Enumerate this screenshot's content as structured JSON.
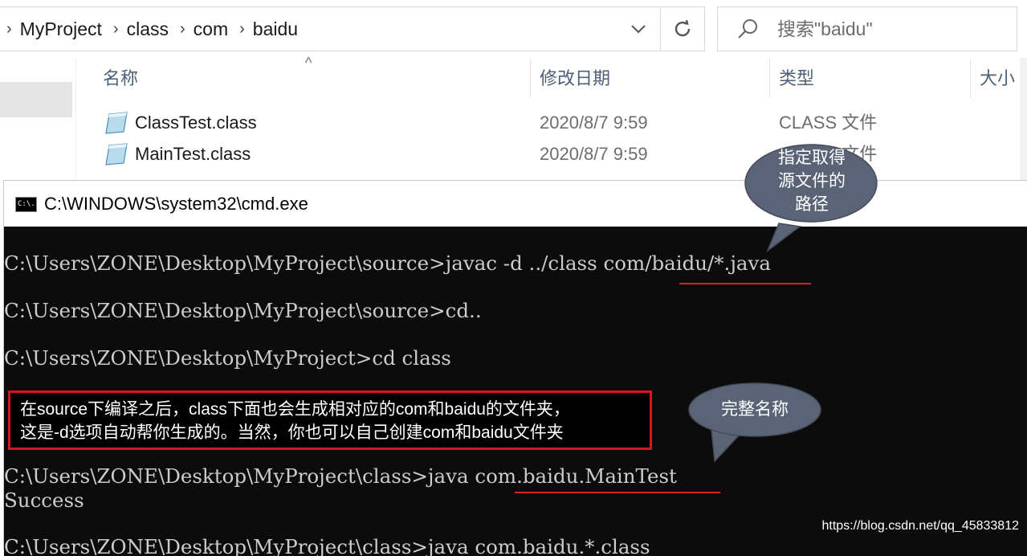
{
  "address_bar": {
    "breadcrumbs": [
      "MyProject",
      "class",
      "com",
      "baidu"
    ],
    "search_placeholder": "搜索\"baidu\""
  },
  "file_list": {
    "columns": [
      "名称",
      "修改日期",
      "类型",
      "大小"
    ],
    "rows": [
      {
        "name": "ClassTest.class",
        "modified": "2020/8/7 9:59",
        "type": "CLASS 文件"
      },
      {
        "name": "MainTest.class",
        "modified": "2020/8/7 9:59",
        "type": "CLASS 文件"
      }
    ]
  },
  "cmd": {
    "title": "C:\\WINDOWS\\system32\\cmd.exe",
    "icon_text": "C:\\.",
    "lines": [
      "C:\\Users\\ZONE\\Desktop\\MyProject\\source>javac -d ../class com/baidu/*.java",
      "C:\\Users\\ZONE\\Desktop\\MyProject\\source>cd..",
      "C:\\Users\\ZONE\\Desktop\\MyProject>cd class",
      "C:\\Users\\ZONE\\Desktop\\MyProject\\class>java com.baidu.MainTest",
      "Success",
      "C:\\Users\\ZONE\\Desktop\\MyProject\\class>java com.baidu.*.class"
    ]
  },
  "annotations": {
    "note_lines": [
      "在source下编译之后，class下面也会生成相对应的com和baidu的文件夹，",
      "这是-d选项自动帮你生成的。当然，你也可以自己创建com和baidu文件夹"
    ],
    "bubble_path": [
      "指定取得",
      "源文件的",
      "路径"
    ],
    "bubble_name": "完整名称"
  },
  "watermark": "https://blog.csdn.net/qq_45833812",
  "colors": {
    "console_bg": "#0c0c0c",
    "console_text": "#cccccc",
    "underline": "#e02020",
    "note_border": "#d9141c",
    "bubble_fill": "#5b6477",
    "header_text": "#4c607a"
  }
}
